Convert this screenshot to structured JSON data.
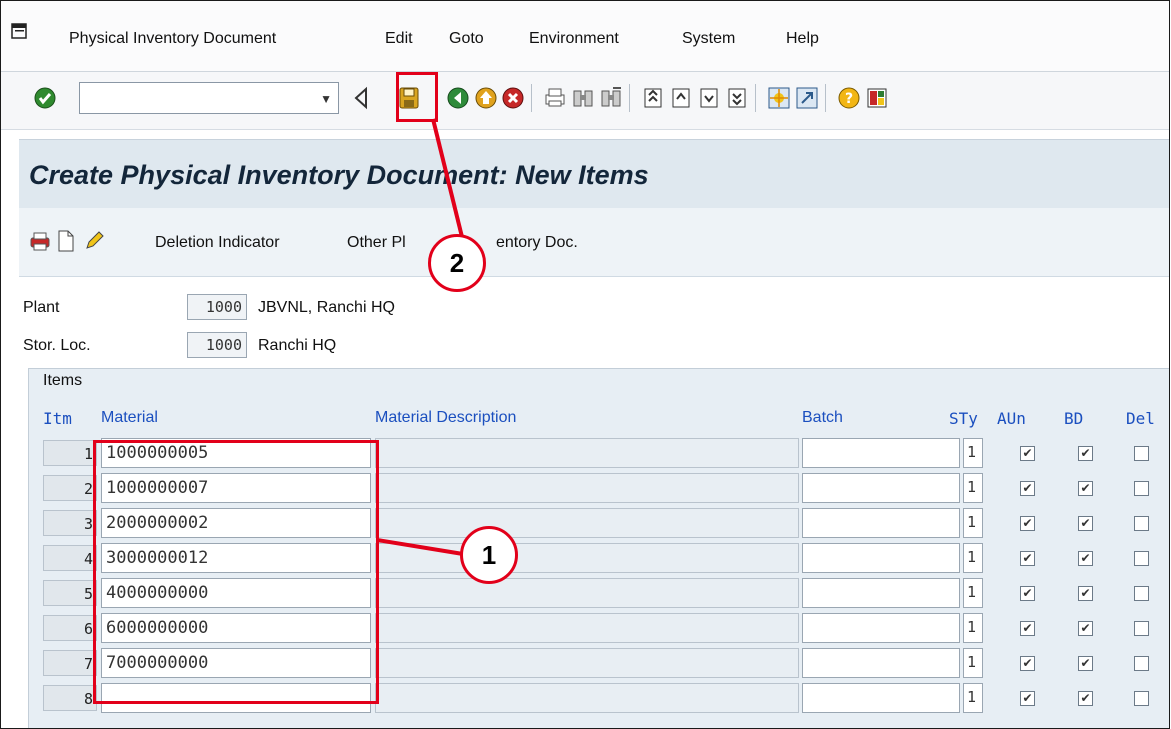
{
  "menu": {
    "items": [
      "Physical Inventory Document",
      "Edit",
      "Goto",
      "Environment",
      "System",
      "Help"
    ]
  },
  "toolbar": {
    "command_value": "",
    "icons": [
      "check-icon",
      "command-dropdown-icon",
      "back-triangle-icon",
      "save-icon",
      "back-icon",
      "exit-icon",
      "cancel-icon",
      "print-icon",
      "find-icon",
      "find-next-icon",
      "first-page-icon",
      "previous-page-icon",
      "next-page-icon",
      "last-page-icon",
      "create-session-icon",
      "shortcut-icon",
      "help-icon",
      "layout-icon"
    ]
  },
  "screen": {
    "title": "Create Physical Inventory Document: New Items",
    "app_toolbar": {
      "deletion_indicator": "Deletion Indicator",
      "other_doc_left": "Other Pl",
      "other_doc_right": "entory Doc."
    }
  },
  "header": {
    "plant_label": "Plant",
    "plant_code": "1000",
    "plant_name": "JBVNL, Ranchi HQ",
    "storloc_label": "Stor. Loc.",
    "storloc_code": "1000",
    "storloc_name": "Ranchi HQ"
  },
  "items": {
    "title": "Items",
    "columns": {
      "itm": "Itm",
      "material": "Material",
      "description": "Material Description",
      "batch": "Batch",
      "sty": "STy",
      "aun": "AUn",
      "bd": "BD",
      "del": "Del"
    },
    "rows": [
      {
        "itm": "1",
        "material": "1000000005",
        "description": "",
        "batch": "",
        "sty": "1",
        "aun": true,
        "bd": true,
        "del": false
      },
      {
        "itm": "2",
        "material": "1000000007",
        "description": "",
        "batch": "",
        "sty": "1",
        "aun": true,
        "bd": true,
        "del": false
      },
      {
        "itm": "3",
        "material": "2000000002",
        "description": "",
        "batch": "",
        "sty": "1",
        "aun": true,
        "bd": true,
        "del": false
      },
      {
        "itm": "4",
        "material": "3000000012",
        "description": "",
        "batch": "",
        "sty": "1",
        "aun": true,
        "bd": true,
        "del": false
      },
      {
        "itm": "5",
        "material": "4000000000",
        "description": "",
        "batch": "",
        "sty": "1",
        "aun": true,
        "bd": true,
        "del": false
      },
      {
        "itm": "6",
        "material": "6000000000",
        "description": "",
        "batch": "",
        "sty": "1",
        "aun": true,
        "bd": true,
        "del": false
      },
      {
        "itm": "7",
        "material": "7000000000",
        "description": "",
        "batch": "",
        "sty": "1",
        "aun": true,
        "bd": true,
        "del": false
      },
      {
        "itm": "8",
        "material": "",
        "description": "",
        "batch": "",
        "sty": "1",
        "aun": true,
        "bd": true,
        "del": false
      }
    ]
  },
  "annotations": {
    "callout_1": "1",
    "callout_2": "2",
    "color": "#e2001a"
  },
  "colors": {
    "title_bar": "#dfe8ef",
    "column_header": "#1b4fbf",
    "items_bg": "#e7eef4"
  }
}
